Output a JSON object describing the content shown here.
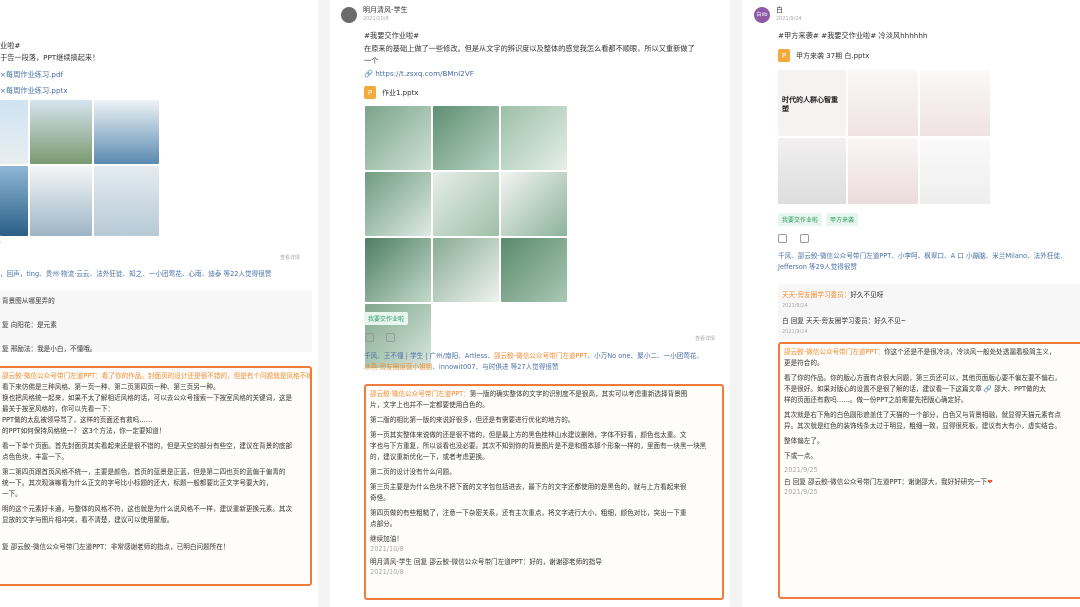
{
  "col1": {
    "lines": [
      "业啦#",
      "于告一段落，PPT继续搞起来！"
    ],
    "files": [
      "×每周作业练习.pdf",
      "×每周作业练习.pptx"
    ],
    "more": "查看详情",
    "likers_prefix": "“",
    "likers": "，回声，ting、贵州·物流·云云、法外狂徒、知之、一小团莺花、心雨、迪泰 等22人觉得很赞",
    "comments": [
      "背景图从哪里弄的",
      "复 向阳花：是元素",
      "复 邢励法：我是小白，不懂哦。"
    ],
    "review": [
      "邵云鲛·微信公众号带门左道PPT：看了你的作品。封面页的设计还是很不错的，但是有个问题就是风格不统",
      "看下来仿佛是三种风格、第一页一种、第二页第四页一种、第三页另一种。",
      "",
      "换也把风格统一起来，如果不太了解相近风格的话，可以去公众号搜索一下按室风格的关键词，这是",
      "最关于按室风格的，你可以先看一下：",
      "PPT做的太乱被领导骂了，这样的页面还有救吗……",
      "的PPT如何保持风格统一？ 这3个方法，你一定要知道！",
      "看一下单个页面。首先封面页其实看起来还是很不错的，但是天空的部分有些空，建议在背景的底部",
      "点色色块，丰富一下。",
      "",
      "第二第四页跟首页风格不统一，主要是颜色，首页的蓝景是正蓝，但是第二四也页的蓝偏于偏青的",
      "统一下。其次观演嘛看为什么正文的字号比小标题的还大，标题一般都要比正文字号要大的，",
      "一下。",
      "",
      "明的这个元素好卡通，与整体的风格不符，这也就是为什么说风格不一样，建议重新更换元素。其次",
      "显放的文字与图片相冲突，看不清楚，建议可以使用蒙版。"
    ],
    "reply": "复 邵云鲛-微信公众号带门左道PPT：非常感谢老师的指点，已明白问题所在！"
  },
  "col2": {
    "user": "明月清风-学生",
    "date": "2021/10/8",
    "tag_line": "#我要交作业啦#",
    "text1": "在原来的基础上做了一些修改。但是从文字的辨识度以及整体的感觉我怎么看都不顺眼，所以又重新做了",
    "text2": "一个",
    "link": "https://t.zsxq.com/BMnI2VF",
    "file": "作业1.pptx",
    "tag": "我要交作业啦",
    "more": "查看详情",
    "likers_a": "千风、王不懂 | 学生 | 广州/南阳、Artless、",
    "likers_b": "邵云鲛-微信公众号带门左道PPT",
    "likers_c": "、小万No one、聚小二、一小团莺花、",
    "likers_d": "冰燕-旁友圈运营小姐姐",
    "likers_e": "、innowit007、与时俱进 等27人觉得很赞",
    "review": [
      "邵云鲛·微信公众号带门左道PPT：第一版的确实整体的文字的识别度不是很高，其实可以考虑重新选择背景图",
      "片，文字上也并不一定都要使用白色的。",
      "",
      "第二版的相比第一版的来说好很多，但还是有需要进行优化的地方的。",
      "",
      "第一页其实整体来说做的还是很不错的，但是最上方的黑色桂林山水建议删除，字体不好看，颜色也太重。文",
      "字也与下方重复，所以谈看也没必要。其次不知到你的背景图片是不是和图本那个形象一样的，里面有一块黑一块黑",
      "的，建议重新优化一下，或者考虑更换。",
      "",
      "第二页的设计没有什么问题。",
      "",
      "第三页主要是为什么色块不把下面的文字包包括进去，最下方的文字还都使用的是黑色的，就与上方看起来很",
      "奇怪。",
      "",
      "第四页做的有些粗糙了，注意一下杂密关系，还有主次重点，将文字进行大小，粗细，颜色对比，突出一下重",
      "点部分。",
      "",
      "继续加油！"
    ],
    "review_date": "2021/10/8",
    "reply": "明月清风-学生 回复 邵云鲛-微信公众号带门左道PPT：好的，谢谢邵老师的指导",
    "reply_date": "2021/10/8"
  },
  "col3": {
    "user": "白",
    "date": "2021/9/24",
    "avatar": "白iib",
    "tag_line": "#甲方来袭# #我要交作业啦# 冷淡风hhhhhh",
    "file": "甲方来袭 37期 白.pptx",
    "thumb_text": "时代的人群心智重塑",
    "tags": [
      "我要交作业啦",
      "甲方来袭"
    ],
    "likers": "千风、邵云鲛-微信公众号带门左道PPT、小李呵、枫翠口、A 口 小蹦脑、米兰Milano、法外狂徒、Jefferson 等29人觉得很赞",
    "c1_name": "天天-旁友圈学习委员：",
    "c1_text": "好久不见呀",
    "c1_date": "2021/9/24",
    "c2": "白 回复 天天-旁友圈学习委员：好久不见~",
    "c2_date": "2021/9/24",
    "review": [
      "邵云鲛-微信公众号带门左道PPT：你这个还是不是很冷淡，冷淡风一般处处透漏着极简主义，",
      "更是符合的。",
      "",
      "看了你的作品。你的版心方面有点很大问题，第三页还可以，其他页面版心要不偏左要不偏右，",
      "不是很好。如果对版心的设置不是很了解的话，建议看一下这篇文章 🔗 邵大、PPT做的太",
      "样的页面还有救吗……。做一份PPT之前需要先把版心确定好。",
      "",
      "我们看一下单个页面。首先封面页整体有些偏右了，建议往左来一点，自己画个版心位置比较好。",
      "其次就是右下角的白色圆形遮盖住了天猫的一个部分，白色又与背景相融，就显得天猫元素有点",
      "异。其次就是红色的装饰线条太过于明显，粗细一致，显得很死板，建议有大有小，虚实结合。",
      "",
      "第二页为什么要加白色色块呢？我感觉不加白色色块可能会更好哦。这页主要是版心的控制不够，",
      "整体偏左了。",
      "",
      "第三页的设计还不错，就是文本内容信息有些靠上，猫头和上方距离太远，会显空。建议往下放一",
      "下或一点。",
      "",
      "第四页的排版很乱，左面很空，建议重新更换一下版式。",
      "",
      "继续加油！"
    ],
    "review_date": "2021/9/25",
    "reply": "白 回复 邵云鲛-微信公众号带门左道PPT：谢谢邵大，我好好研究一下",
    "reply_date": "2021/9/25"
  }
}
